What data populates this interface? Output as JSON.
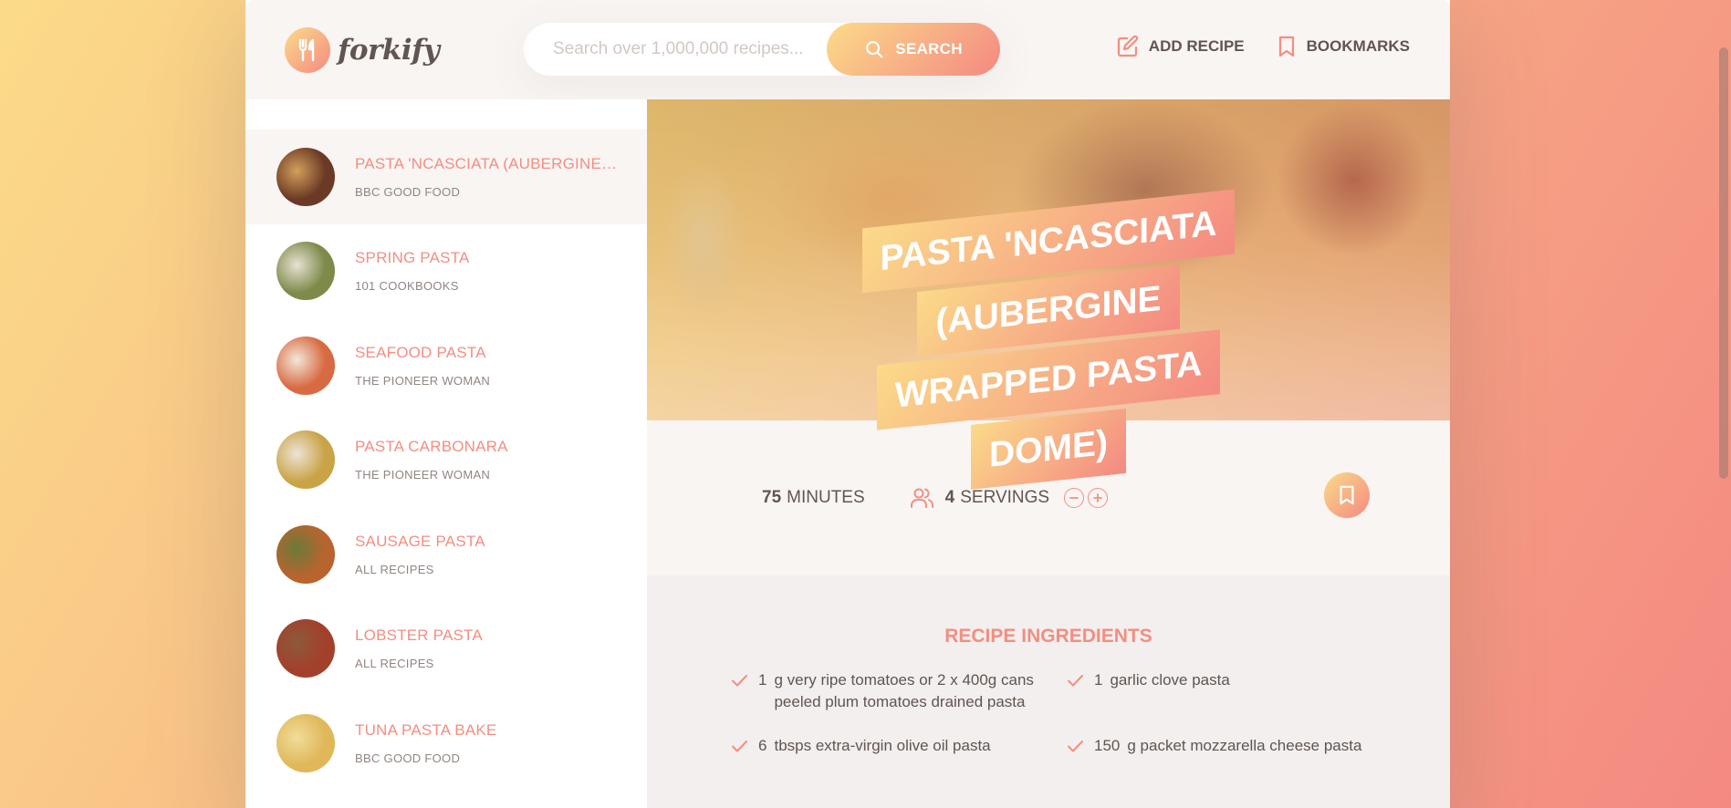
{
  "brand": {
    "name": "forkify"
  },
  "search": {
    "placeholder": "Search over 1,000,000 recipes...",
    "button_label": "SEARCH"
  },
  "nav": {
    "add_recipe": "ADD RECIPE",
    "bookmarks": "BOOKMARKS"
  },
  "results": [
    {
      "title": "Pasta 'ncasciata (aubergine wrapped pasta dome)",
      "publisher": "BBC Good Food",
      "active": true,
      "thumb_colors": [
        "#6b3a26",
        "#d4a05a"
      ]
    },
    {
      "title": "Spring pasta",
      "publisher": "101 Cookbooks",
      "active": false,
      "thumb_colors": [
        "#7d8a4a",
        "#e8e2d2"
      ]
    },
    {
      "title": "Seafood Pasta",
      "publisher": "The Pioneer Woman",
      "active": false,
      "thumb_colors": [
        "#d86a43",
        "#f2e8d8"
      ]
    },
    {
      "title": "Pasta Carbonara",
      "publisher": "The Pioneer Woman",
      "active": false,
      "thumb_colors": [
        "#c9a447",
        "#ece4d6"
      ]
    },
    {
      "title": "Sausage Pasta",
      "publisher": "All Recipes",
      "active": false,
      "thumb_colors": [
        "#b8642e",
        "#6b7a3a"
      ]
    },
    {
      "title": "Lobster Pasta",
      "publisher": "All Recipes",
      "active": false,
      "thumb_colors": [
        "#a3402b",
        "#8c5a3c"
      ]
    },
    {
      "title": "Tuna Pasta Bake",
      "publisher": "BBC Good Food",
      "active": false,
      "thumb_colors": [
        "#e0b85a",
        "#f1dd9a"
      ]
    }
  ],
  "recipe": {
    "title": "Pasta 'ncasciata (aubergine wrapped pasta dome)",
    "cooking_time": "75",
    "cooking_time_unit": "minutes",
    "servings": "4",
    "servings_unit": "servings",
    "ingredients_heading": "Recipe ingredients",
    "ingredients": [
      {
        "quantity": "1",
        "description": "g very ripe tomatoes or 2 x 400g cans peeled plum tomatoes drained pasta"
      },
      {
        "quantity": "1",
        "description": "garlic clove pasta"
      },
      {
        "quantity": "6",
        "description": "tbsps extra-virgin olive oil pasta"
      },
      {
        "quantity": "150",
        "description": "g packet mozzarella cheese pasta"
      }
    ]
  },
  "colors": {
    "accent_start": "#fbdb89",
    "accent_end": "#f48982",
    "text": "#615551",
    "accent_text": "#f38e82"
  }
}
